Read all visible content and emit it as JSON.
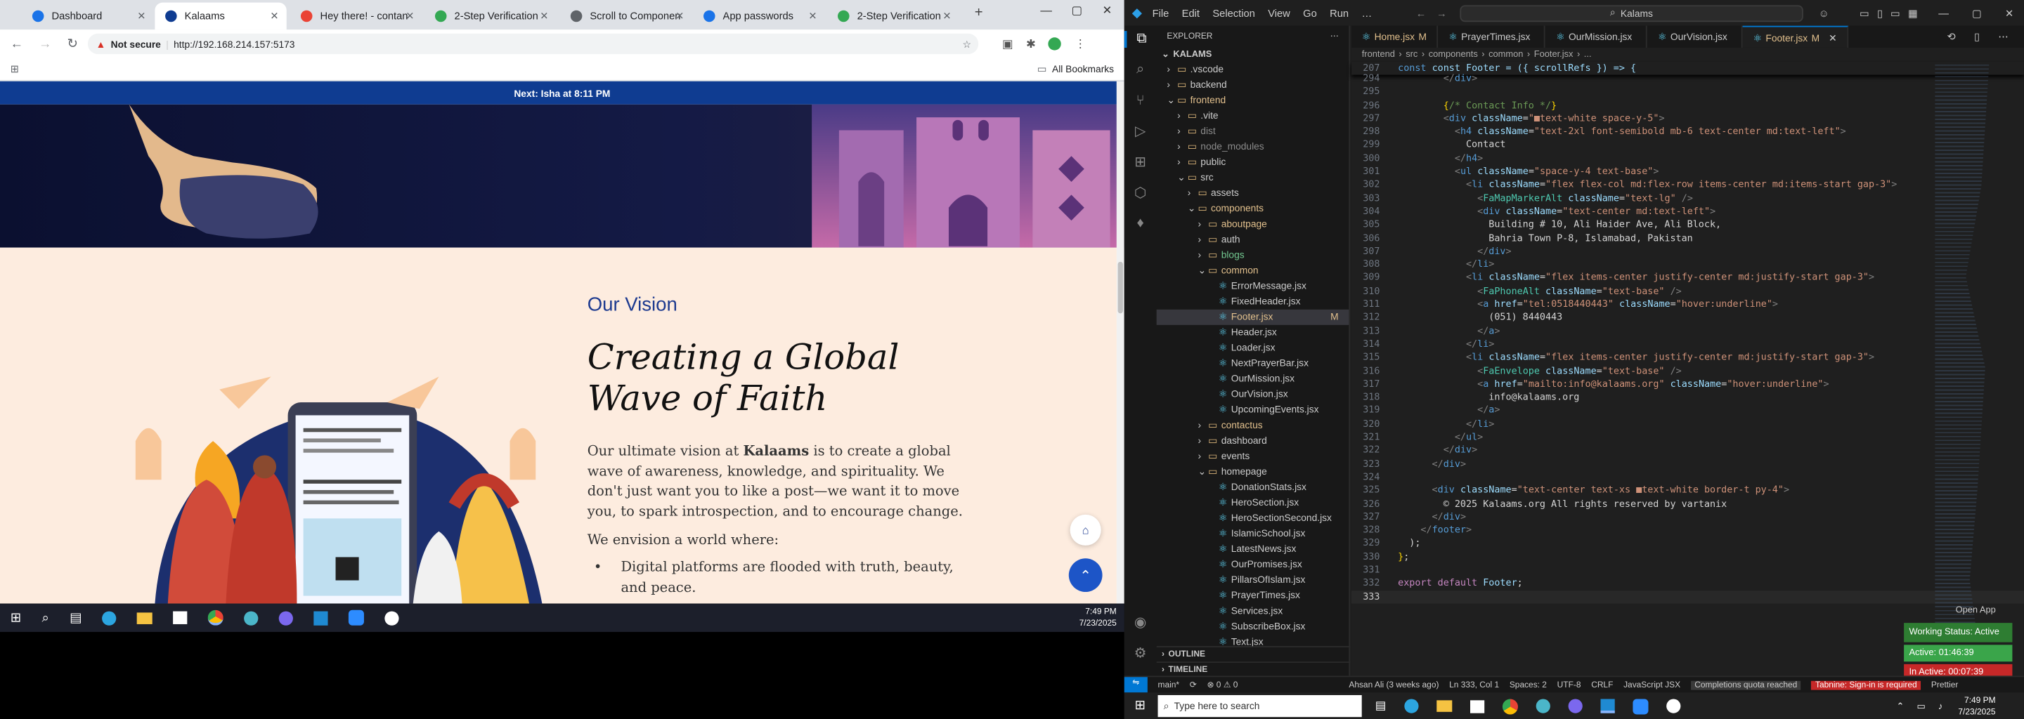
{
  "browser": {
    "tabs": [
      {
        "label": "Dashboard",
        "color": "#1a73e8"
      },
      {
        "label": "Kalaams",
        "color": "#0f3c91"
      },
      {
        "label": "Hey there! - contan",
        "color": "#ea4335"
      },
      {
        "label": "2-Step Verification",
        "color": "#34a853"
      },
      {
        "label": "Scroll to Components",
        "color": "#5f6368"
      },
      {
        "label": "App passwords",
        "color": "#1a73e8"
      },
      {
        "label": "2-Step Verification",
        "color": "#34a853"
      }
    ],
    "not_secure": "Not secure",
    "url": "http://192.168.214.157:5173",
    "all_bookmarks": "All Bookmarks",
    "prayer_bar": "Next: Isha at 8:11 PM"
  },
  "website": {
    "eyebrow": "Our Vision",
    "heading_line1": "Creating a Global",
    "heading_line2": "Wave of Faith",
    "para_prefix": "Our ultimate vision at ",
    "para_brand": "Kalaams",
    "para_suffix": " is to create a global wave of awareness, knowledge, and spirituality. We don't just want you to like a post—we want it to move you, to spark introspection, and to encourage change.",
    "envision": "We envision a world where:",
    "bullet1": "Digital platforms are flooded with truth, beauty, and peace."
  },
  "taskbar_left": {
    "time": "7:49 PM",
    "date": "7/23/2025"
  },
  "vscode": {
    "menu": [
      "File",
      "Edit",
      "Selection",
      "View",
      "Go",
      "Run"
    ],
    "search": "Kalams",
    "explorer_title": "EXPLORER",
    "root": "KALAMS",
    "tree": [
      {
        "label": ".vscode",
        "depth": 1,
        "type": "folder",
        "open": false
      },
      {
        "label": "backend",
        "depth": 1,
        "type": "folder",
        "open": false
      },
      {
        "label": "frontend",
        "depth": 1,
        "type": "folder",
        "open": true,
        "color": "#e2c08d"
      },
      {
        "label": ".vite",
        "depth": 2,
        "type": "folder",
        "open": false
      },
      {
        "label": "dist",
        "depth": 2,
        "type": "folder",
        "open": false,
        "color": "#8b8b8b"
      },
      {
        "label": "node_modules",
        "depth": 2,
        "type": "folder",
        "open": false,
        "color": "#8b8b8b"
      },
      {
        "label": "public",
        "depth": 2,
        "type": "folder",
        "open": false
      },
      {
        "label": "src",
        "depth": 2,
        "type": "folder",
        "open": true
      },
      {
        "label": "assets",
        "depth": 3,
        "type": "folder",
        "open": false
      },
      {
        "label": "components",
        "depth": 3,
        "type": "folder",
        "open": true,
        "color": "#e2c08d"
      },
      {
        "label": "aboutpage",
        "depth": 4,
        "type": "folder",
        "open": false,
        "color": "#e2c08d"
      },
      {
        "label": "auth",
        "depth": 4,
        "type": "folder",
        "open": false
      },
      {
        "label": "blogs",
        "depth": 4,
        "type": "folder",
        "open": false,
        "color": "#73c991"
      },
      {
        "label": "common",
        "depth": 4,
        "type": "folder",
        "open": true,
        "color": "#e2c08d"
      },
      {
        "label": "ErrorMessage.jsx",
        "depth": 5,
        "type": "file"
      },
      {
        "label": "FixedHeader.jsx",
        "depth": 5,
        "type": "file"
      },
      {
        "label": "Footer.jsx",
        "depth": 5,
        "type": "file",
        "selected": true,
        "badge": "M",
        "color": "#e2c08d"
      },
      {
        "label": "Header.jsx",
        "depth": 5,
        "type": "file"
      },
      {
        "label": "Loader.jsx",
        "depth": 5,
        "type": "file"
      },
      {
        "label": "NextPrayerBar.jsx",
        "depth": 5,
        "type": "file"
      },
      {
        "label": "OurMission.jsx",
        "depth": 5,
        "type": "file"
      },
      {
        "label": "OurVision.jsx",
        "depth": 5,
        "type": "file"
      },
      {
        "label": "UpcomingEvents.jsx",
        "depth": 5,
        "type": "file"
      },
      {
        "label": "contactus",
        "depth": 4,
        "type": "folder",
        "open": false,
        "color": "#e2c08d"
      },
      {
        "label": "dashboard",
        "depth": 4,
        "type": "folder",
        "open": false
      },
      {
        "label": "events",
        "depth": 4,
        "type": "folder",
        "open": false
      },
      {
        "label": "homepage",
        "depth": 4,
        "type": "folder",
        "open": true
      },
      {
        "label": "DonationStats.jsx",
        "depth": 5,
        "type": "file"
      },
      {
        "label": "HeroSection.jsx",
        "depth": 5,
        "type": "file"
      },
      {
        "label": "HeroSectionSecond.jsx",
        "depth": 5,
        "type": "file"
      },
      {
        "label": "IslamicSchool.jsx",
        "depth": 5,
        "type": "file"
      },
      {
        "label": "LatestNews.jsx",
        "depth": 5,
        "type": "file"
      },
      {
        "label": "OurPromises.jsx",
        "depth": 5,
        "type": "file"
      },
      {
        "label": "PillarsOfIslam.jsx",
        "depth": 5,
        "type": "file"
      },
      {
        "label": "PrayerTimes.jsx",
        "depth": 5,
        "type": "file"
      },
      {
        "label": "Services.jsx",
        "depth": 5,
        "type": "file"
      },
      {
        "label": "SubscribeBox.jsx",
        "depth": 5,
        "type": "file"
      },
      {
        "label": "Text.jsx",
        "depth": 5,
        "type": "file"
      }
    ],
    "outline": "OUTLINE",
    "timeline": "TIMELINE",
    "editor_tabs": [
      {
        "label": "Home.jsx",
        "badge": "M"
      },
      {
        "label": "PrayerTimes.jsx",
        "badge": ""
      },
      {
        "label": "OurMission.jsx",
        "badge": ""
      },
      {
        "label": "OurVision.jsx",
        "badge": ""
      },
      {
        "label": "Footer.jsx",
        "badge": "M",
        "active": true
      }
    ],
    "breadcrumb": [
      "frontend",
      "src",
      "components",
      "common",
      "Footer.jsx",
      "..."
    ],
    "sticky_line": {
      "num": "207",
      "text": "const Footer = ({ scrollRefs }) => {"
    },
    "code_lines": [
      {
        "n": "294",
        "html": "        <span class='p'>&lt;/</span><span class='t'>div</span><span class='p'>&gt;</span>"
      },
      {
        "n": "295",
        "html": ""
      },
      {
        "n": "296",
        "html": "        <span class='b'>{</span><span class='cm'>/* Contact Info */</span><span class='b'>}</span>"
      },
      {
        "n": "297",
        "html": "        <span class='p'>&lt;</span><span class='t'>div</span> <span class='a'>className</span><span class='w'>=</span><span class='st'>\"■text-white space-y-5\"</span><span class='p'>&gt;</span>"
      },
      {
        "n": "298",
        "html": "          <span class='p'>&lt;</span><span class='t'>h4</span> <span class='a'>className</span><span class='w'>=</span><span class='st'>\"text-2xl font-semibold mb-6 text-center md:text-left\"</span><span class='p'>&gt;</span>"
      },
      {
        "n": "299",
        "html": "            <span class='w'>Contact</span>"
      },
      {
        "n": "300",
        "html": "          <span class='p'>&lt;/</span><span class='t'>h4</span><span class='p'>&gt;</span>"
      },
      {
        "n": "301",
        "html": "          <span class='p'>&lt;</span><span class='t'>ul</span> <span class='a'>className</span><span class='w'>=</span><span class='st'>\"space-y-4 text-base\"</span><span class='p'>&gt;</span>"
      },
      {
        "n": "302",
        "html": "            <span class='p'>&lt;</span><span class='t'>li</span> <span class='a'>className</span><span class='w'>=</span><span class='st'>\"flex flex-col md:flex-row items-center md:items-start gap-3\"</span><span class='p'>&gt;</span>"
      },
      {
        "n": "303",
        "html": "              <span class='p'>&lt;</span><span class='g'>FaMapMarkerAlt</span> <span class='a'>className</span><span class='w'>=</span><span class='st'>\"text-lg\"</span> <span class='p'>/&gt;</span>"
      },
      {
        "n": "304",
        "html": "              <span class='p'>&lt;</span><span class='t'>div</span> <span class='a'>className</span><span class='w'>=</span><span class='st'>\"text-center md:text-left\"</span><span class='p'>&gt;</span>"
      },
      {
        "n": "305",
        "html": "                <span class='w'>Building # 10, Ali Haider Ave, Ali Block,</span>"
      },
      {
        "n": "306",
        "html": "                <span class='w'>Bahria Town P-8, Islamabad, Pakistan</span>"
      },
      {
        "n": "307",
        "html": "              <span class='p'>&lt;/</span><span class='t'>div</span><span class='p'>&gt;</span>"
      },
      {
        "n": "308",
        "html": "            <span class='p'>&lt;/</span><span class='t'>li</span><span class='p'>&gt;</span>"
      },
      {
        "n": "309",
        "html": "            <span class='p'>&lt;</span><span class='t'>li</span> <span class='a'>className</span><span class='w'>=</span><span class='st'>\"flex items-center justify-center md:justify-start gap-3\"</span><span class='p'>&gt;</span>"
      },
      {
        "n": "310",
        "html": "              <span class='p'>&lt;</span><span class='g'>FaPhoneAlt</span> <span class='a'>className</span><span class='w'>=</span><span class='st'>\"text-base\"</span> <span class='p'>/&gt;</span>"
      },
      {
        "n": "311",
        "html": "              <span class='p'>&lt;</span><span class='t'>a</span> <span class='a'>href</span><span class='w'>=</span><span class='st'>\"tel:0518440443\"</span> <span class='a'>className</span><span class='w'>=</span><span class='st'>\"hover:underline\"</span><span class='p'>&gt;</span>"
      },
      {
        "n": "312",
        "html": "                <span class='w'>(051) 8440443</span>"
      },
      {
        "n": "313",
        "html": "              <span class='p'>&lt;/</span><span class='t'>a</span><span class='p'>&gt;</span>"
      },
      {
        "n": "314",
        "html": "            <span class='p'>&lt;/</span><span class='t'>li</span><span class='p'>&gt;</span>"
      },
      {
        "n": "315",
        "html": "            <span class='p'>&lt;</span><span class='t'>li</span> <span class='a'>className</span><span class='w'>=</span><span class='st'>\"flex items-center justify-center md:justify-start gap-3\"</span><span class='p'>&gt;</span>"
      },
      {
        "n": "316",
        "html": "              <span class='p'>&lt;</span><span class='g'>FaEnvelope</span> <span class='a'>className</span><span class='w'>=</span><span class='st'>\"text-base\"</span> <span class='p'>/&gt;</span>"
      },
      {
        "n": "317",
        "html": "              <span class='p'>&lt;</span><span class='t'>a</span> <span class='a'>href</span><span class='w'>=</span><span class='st'>\"mailto:info@kalaams.org\"</span> <span class='a'>className</span><span class='w'>=</span><span class='st'>\"hover:underline\"</span><span class='p'>&gt;</span>"
      },
      {
        "n": "318",
        "html": "                <span class='w'>info@kalaams.org</span>"
      },
      {
        "n": "319",
        "html": "              <span class='p'>&lt;/</span><span class='t'>a</span><span class='p'>&gt;</span>"
      },
      {
        "n": "320",
        "html": "            <span class='p'>&lt;/</span><span class='t'>li</span><span class='p'>&gt;</span>"
      },
      {
        "n": "321",
        "html": "          <span class='p'>&lt;/</span><span class='t'>ul</span><span class='p'>&gt;</span>"
      },
      {
        "n": "322",
        "html": "        <span class='p'>&lt;/</span><span class='t'>div</span><span class='p'>&gt;</span>"
      },
      {
        "n": "323",
        "html": "      <span class='p'>&lt;/</span><span class='t'>div</span><span class='p'>&gt;</span>"
      },
      {
        "n": "324",
        "html": ""
      },
      {
        "n": "325",
        "html": "      <span class='p'>&lt;</span><span class='t'>div</span> <span class='a'>className</span><span class='w'>=</span><span class='st'>\"text-center text-xs ■text-white border-t py-4\"</span><span class='p'>&gt;</span>"
      },
      {
        "n": "326",
        "html": "        <span class='w'>© 2025 Kalaams.org All rights reserved by vartanix</span>"
      },
      {
        "n": "327",
        "html": "      <span class='p'>&lt;/</span><span class='t'>div</span><span class='p'>&gt;</span>"
      },
      {
        "n": "328",
        "html": "    <span class='p'>&lt;/</span><span class='t'>footer</span><span class='p'>&gt;</span>"
      },
      {
        "n": "329",
        "html": "  <span class='w'>);</span>"
      },
      {
        "n": "330",
        "html": "<span class='b'>}</span><span class='w'>;</span>"
      },
      {
        "n": "331",
        "html": ""
      },
      {
        "n": "332",
        "html": "<span class='k'>export default</span> <span class='a'>Footer</span><span class='w'>;</span>"
      },
      {
        "n": "333",
        "html": ""
      }
    ],
    "open_app": "Open App",
    "working_status": "Working Status: Active",
    "active_time": "Active: 01:46:39",
    "inactive_time": "In Active: 00:07:39",
    "status": {
      "branch": "main*",
      "problems": "⊗ 0 ⚠ 0",
      "author": "Ahsan Ali (3 weeks ago)",
      "position": "Ln 333, Col 1",
      "spaces": "Spaces: 2",
      "encoding": "UTF-8",
      "eol": "CRLF",
      "language": "JavaScript JSX",
      "quota": "Completions quota reached",
      "tabnine": "Tabnine: Sign-in is required",
      "prettier": "Prettier"
    }
  },
  "taskbar_right": {
    "search_placeholder": "Type here to search",
    "time": "7:49 PM",
    "date": "7/23/2025"
  }
}
